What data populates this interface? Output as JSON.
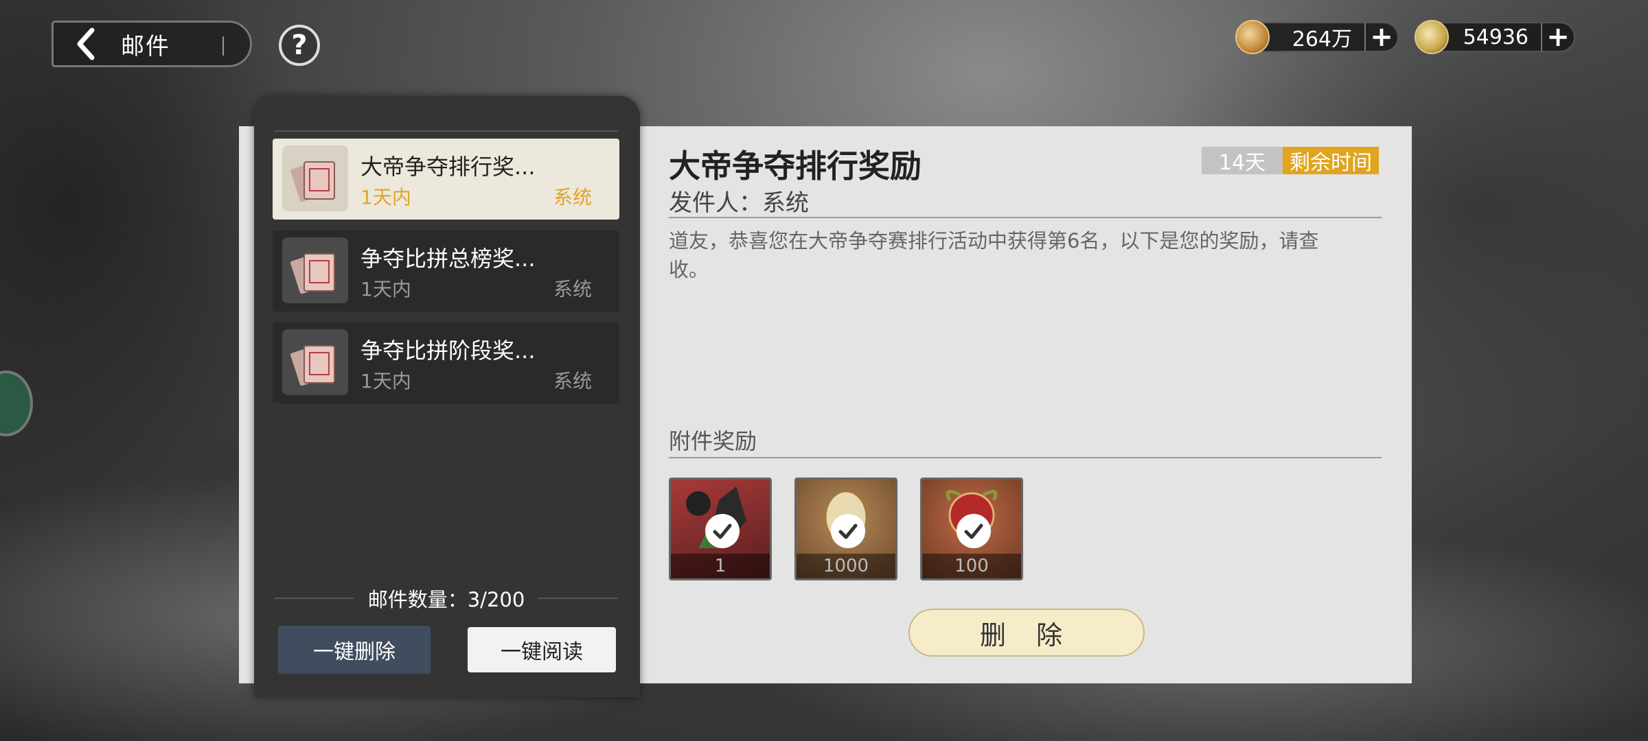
{
  "header": {
    "title": "邮件",
    "back_icon": "chevron-left-icon",
    "help_label": "?"
  },
  "currencies": [
    {
      "icon": "gold-coin-icon",
      "value": "264万",
      "plus": "+"
    },
    {
      "icon": "key-token-icon",
      "value": "54936",
      "plus": "+"
    }
  ],
  "mail_list": {
    "items": [
      {
        "subject": "大帝争夺排行奖...",
        "time": "1天内",
        "sender": "系统",
        "active": true
      },
      {
        "subject": "争夺比拼总榜奖...",
        "time": "1天内",
        "sender": "系统",
        "active": false
      },
      {
        "subject": "争夺比拼阶段奖...",
        "time": "1天内",
        "sender": "系统",
        "active": false
      }
    ],
    "count_label": "邮件数量：3/200",
    "delete_all_label": "一键删除",
    "read_all_label": "一键阅读"
  },
  "detail": {
    "title": "大帝争夺排行奖励",
    "days": "14天",
    "remaining_label": "剩余时间",
    "sender": "发件人：系统",
    "body": "道友，恭喜您在大帝争夺赛排行活动中获得第6名，以下是您的奖励，请查收。",
    "attachments_label": "附件奖励",
    "attachments": [
      {
        "qty": "1",
        "icon": "fox-character-icon",
        "claimed": true
      },
      {
        "qty": "1000",
        "icon": "egg-item-icon",
        "claimed": true
      },
      {
        "qty": "100",
        "icon": "red-orb-icon",
        "claimed": true
      }
    ],
    "delete_label": "删 除"
  },
  "colors": {
    "accent": "#e0a41e",
    "active_mail_bg": "#ece8dc",
    "delete_all_bg": "#3f4d5e"
  }
}
